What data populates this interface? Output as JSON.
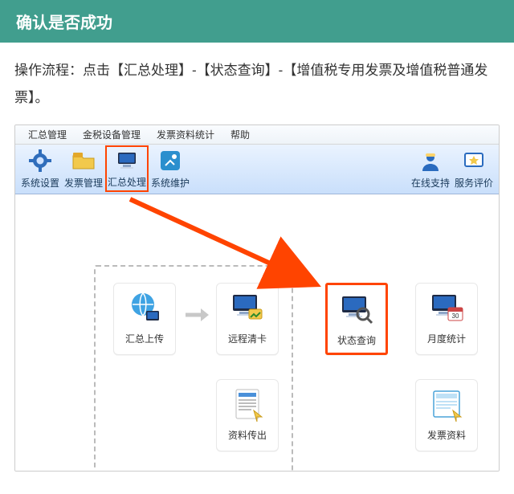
{
  "header": {
    "title": "确认是否成功"
  },
  "instruction": "操作流程：点击【汇总处理】-【状态查询】-【增值税专用发票及增值税普通发票】。",
  "menubar": {
    "items": [
      "汇总管理",
      "金税设备管理",
      "发票资料统计",
      "帮助"
    ]
  },
  "toolbar": {
    "buttons": {
      "system_settings": "系统设置",
      "invoice_mgmt": "发票管理",
      "summary_process": "汇总处理",
      "system_maint": "系统维护",
      "online_support": "在线支持",
      "service_rating": "服务评价"
    }
  },
  "tiles": {
    "upload_summary": "汇总上传",
    "remote_clear": "远程清卡",
    "data_export": "资料传出",
    "status_query": "状态查询",
    "monthly_stats": "月度统计",
    "invoice_data": "发票资料"
  },
  "icons": {
    "gear": "gear-icon",
    "folder": "folder-icon",
    "monitor": "monitor-icon",
    "tools": "tools-icon",
    "person": "support-icon",
    "rating": "rating-icon",
    "globe": "globe-icon",
    "card": "card-monitor-icon",
    "doc": "document-icon",
    "magnifier": "magnifier-monitor-icon",
    "calendar": "calendar-monitor-icon",
    "form": "form-icon"
  },
  "colors": {
    "header_bg": "#419e8e",
    "highlight": "#ff4400",
    "toolbar_top": "#eaf3ff",
    "toolbar_bot": "#c9dffb"
  }
}
